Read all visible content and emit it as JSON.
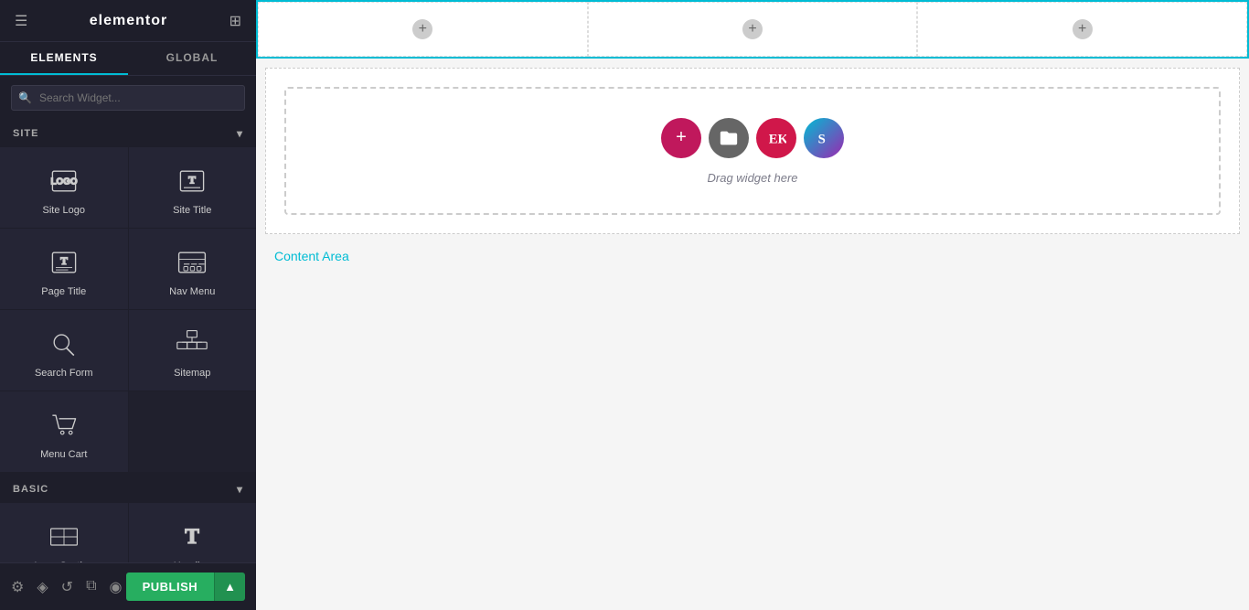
{
  "header": {
    "title": "elementor",
    "hamburger_icon": "☰",
    "grid_icon": "⊞"
  },
  "tabs": [
    {
      "label": "ELEMENTS",
      "active": true
    },
    {
      "label": "GLOBAL",
      "active": false
    }
  ],
  "search": {
    "placeholder": "Search Widget..."
  },
  "site_section": {
    "label": "SITE",
    "arrow": "▾"
  },
  "widgets": [
    {
      "id": "site-logo",
      "label": "Site Logo"
    },
    {
      "id": "site-title",
      "label": "Site Title"
    },
    {
      "id": "page-title",
      "label": "Page Title"
    },
    {
      "id": "nav-menu",
      "label": "Nav Menu"
    },
    {
      "id": "search-form",
      "label": "Search Form"
    },
    {
      "id": "sitemap",
      "label": "Sitemap"
    },
    {
      "id": "menu-cart",
      "label": "Menu Cart"
    }
  ],
  "basic_section": {
    "label": "BASIC",
    "arrow": "▾"
  },
  "canvas": {
    "row_toolbar": {
      "add": "+",
      "move": "⠿",
      "close": "✕"
    },
    "columns": 3,
    "drop_area": {
      "text": "Drag widget here"
    },
    "content_area_label": "Content Area"
  },
  "footer": {
    "publish_label": "PUBLISH",
    "arrow": "▲",
    "icons": [
      "⚙",
      "◈",
      "↺",
      "⧉",
      "◉"
    ]
  }
}
